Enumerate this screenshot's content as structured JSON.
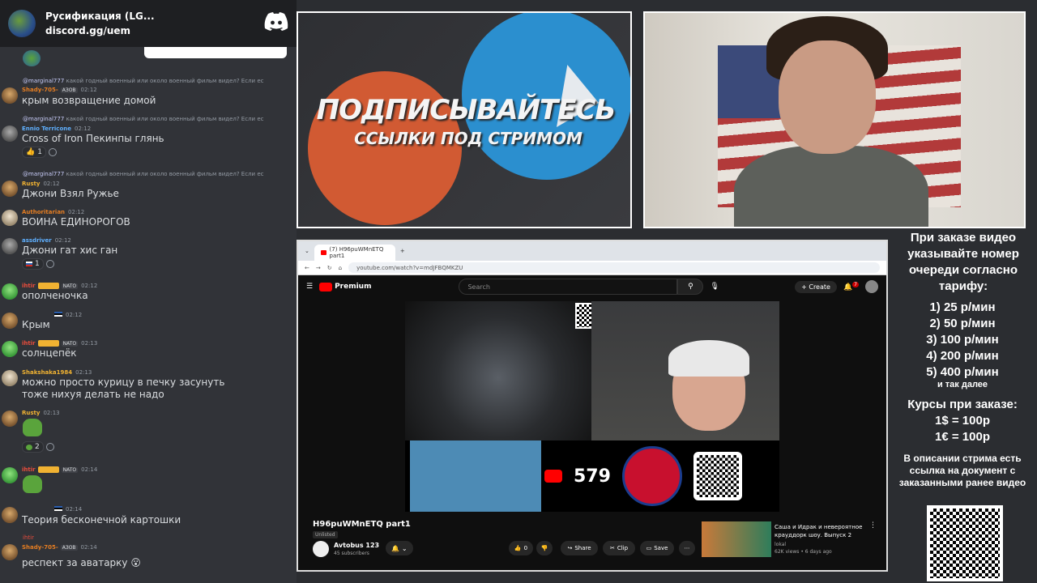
{
  "discord": {
    "server_name": "Русификация (LG...",
    "invite": "discord.gg/uem",
    "messages": [
      {
        "reply_user": "@marginal777",
        "reply_text": "какой годный военный или около военный фильм видел? Если ес",
        "user": "Shady-705-",
        "user_color": "#e67e22",
        "tag": "АЗОВ",
        "time": "02:12",
        "text": "крым возвращение домой"
      },
      {
        "reply_user": "@marginal777",
        "reply_text": "какой годный военный или около военный фильм видел? Если ес",
        "user": "Ennio Terricone",
        "user_color": "#5fb0ff",
        "time": "02:12",
        "text": "Cross of Iron Пекинпы глянь",
        "reaction_emoji": "👍",
        "reaction_count": "1"
      },
      {
        "reply_user": "@marginal777",
        "reply_text": "какой годный военный или около военный фильм видел? Если ес",
        "user": "Rusty",
        "user_color": "#f0b232",
        "time": "02:12",
        "text": "Джони Взял Ружье"
      },
      {
        "user": "Authoritarian",
        "user_color": "#e67e22",
        "time": "02:12",
        "text": "ВОИНА ЕДИНОРОГОВ"
      },
      {
        "user": "assdriver",
        "user_color": "#5fb0ff",
        "time": "02:12",
        "text": "Джони гат хис ган",
        "reaction_count": "1"
      },
      {
        "user": "ihtir",
        "user_color": "#e74c3c",
        "tag": "NATO",
        "time": "02:12",
        "text": "ополченочка"
      },
      {
        "user": "",
        "user_color": "#949ba4",
        "time": "02:12",
        "text": "Крым"
      },
      {
        "user": "ihtir",
        "user_color": "#e74c3c",
        "tag": "NATO",
        "time": "02:13",
        "text": "солнцепёк"
      },
      {
        "user": "Shakshaka1984",
        "user_color": "#f0b232",
        "time": "02:13",
        "text": "можно просто курицу в печку засунуть",
        "text2": "тоже нихуя делать не надо"
      },
      {
        "user": "Rusty",
        "user_color": "#f0b232",
        "time": "02:13",
        "reaction_count": "2"
      },
      {
        "user": "ihtir",
        "user_color": "#e74c3c",
        "tag": "NATO",
        "time": "02:14"
      },
      {
        "user": "",
        "user_color": "#949ba4",
        "time": "02:14",
        "text": "Теория бесконечной картошки"
      },
      {
        "reply_user": "ihtir",
        "user": "Shady-705-",
        "user_color": "#e67e22",
        "tag": "АЗОВ",
        "time": "02:14",
        "text": "респект за аватарку 😮"
      }
    ]
  },
  "promo": {
    "line1": "ПОДПИСЫВАЙТЕСЬ",
    "line2": "ССЫЛКИ ПОД СТРИМОМ"
  },
  "browser": {
    "tab_title": "(7) H96puWMnETQ part1",
    "url": "youtube.com/watch?v=mdJFBQMKZU",
    "brand": "Premium",
    "search_placeholder": "Search",
    "create_label": "Create",
    "notif_count": "7"
  },
  "video": {
    "sub_counter": "579",
    "title": "H96puWMnETQ part1",
    "visibility": "Unlisted",
    "channel": "Avtobus 123",
    "subscribers": "45 subscribers",
    "like_count": "0",
    "share_label": "Share",
    "clip_label": "Clip",
    "save_label": "Save",
    "rec_title": "Саша и Идрак и невероятное крауддорк шоу. Выпуск 2",
    "rec_channel": "lokal",
    "rec_meta": "62K views • 6 days ago"
  },
  "sidebar": {
    "intro": "При заказе видео указывайте номер очереди согласно тарифу:",
    "tariffs": [
      "1) 25 р/мин",
      "2) 50 р/мин",
      "3) 100 р/мин",
      "4) 200 р/мин",
      "5) 400 р/мин"
    ],
    "etc": "и так далее",
    "rates_title": "Курсы при заказе:",
    "rate_usd": "1$ = 100р",
    "rate_eur": "1€ = 100р",
    "footer": "В описании стрима есть ссылка на документ с заказанными ранее видео"
  }
}
